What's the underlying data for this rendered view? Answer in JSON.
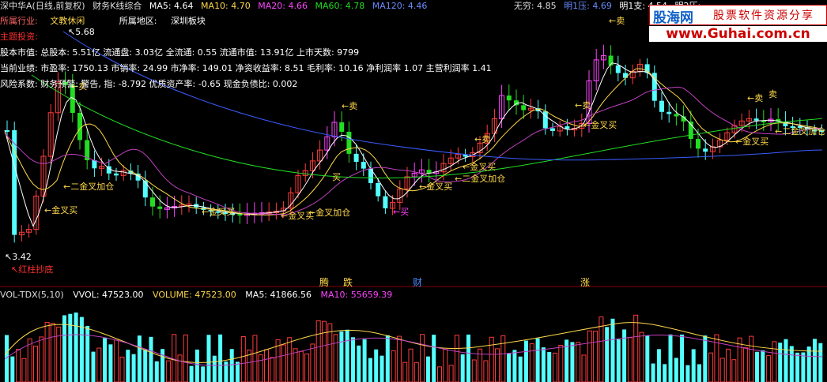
{
  "header": {
    "stock": "深中华A(日线,前复权)",
    "indicator": "财务K线综合",
    "ma5": "MA5: 4.64",
    "ma10": "MA10: 4.70",
    "ma20": "MA20: 4.66",
    "ma60": "MA60: 4.78",
    "ma120": "MA120: 4.46",
    "wuqiong": "无穷: 4.85",
    "mingya": "明1压: 4.69",
    "mingzhi": "明1支: 4.54",
    "ming2ya": "明2压:"
  },
  "info": {
    "industry_label": "所属行业:",
    "industry_value": "文教休闲",
    "region_label": "所属地区:",
    "region_value": "深圳板块",
    "main_label": "主题投资:",
    "row1": "股本市值: 总股本: 5.51亿 流通盘: 3.03亿 全流通: 0.55 流通市值: 13.91亿 上市天数: 9799",
    "row2": "当前业绩: 市盈率: 1750.13 市销率: 24.99 市净率: 149.01 净资收益率: 8.51 毛利率: 10.16 净利润率 1.07 主营利润率 1.41",
    "row3": "风险系数: 财务预警: 警告, 指: -8.792 优质资产率: -0.65 现金负债比: 0.002"
  },
  "logo": {
    "brand": "股海网",
    "slogan": "股票软件资源分享",
    "url": "www.Guhai.com.cn"
  },
  "annotations": {
    "high_price": "5.68",
    "low_price": "3.42",
    "red_bottom": "红柱抄底",
    "sell": "卖",
    "buy": "买",
    "golden_cross_buy": "金叉买",
    "golden_cross_add": "二金叉加仓",
    "golden_cross_add2": "金叉加仓"
  },
  "flags": {
    "teng": "腾",
    "die": "跌",
    "cai": "财",
    "zhang": "涨"
  },
  "volume": {
    "title": "VOL-TDX(5,10)",
    "vvol": "VVOL: 47523.00",
    "volume": "VOLUME: 47523.00",
    "ma5": "MA5: 41866.56",
    "ma10": "MA10: 55659.39"
  },
  "colors": {
    "up": "#ff3c3c",
    "down": "#54ffff",
    "pink": "#ff44ff",
    "green": "#22dd22",
    "blue": "#3a5cff",
    "white": "#ffffff",
    "yellow": "#ffd84a",
    "magenta": "#c040c0"
  },
  "chart_data": {
    "type": "candlestick",
    "price_range": [
      3.42,
      5.68
    ],
    "moving_averages": [
      "MA5",
      "MA10",
      "MA20",
      "MA60",
      "MA120"
    ]
  }
}
